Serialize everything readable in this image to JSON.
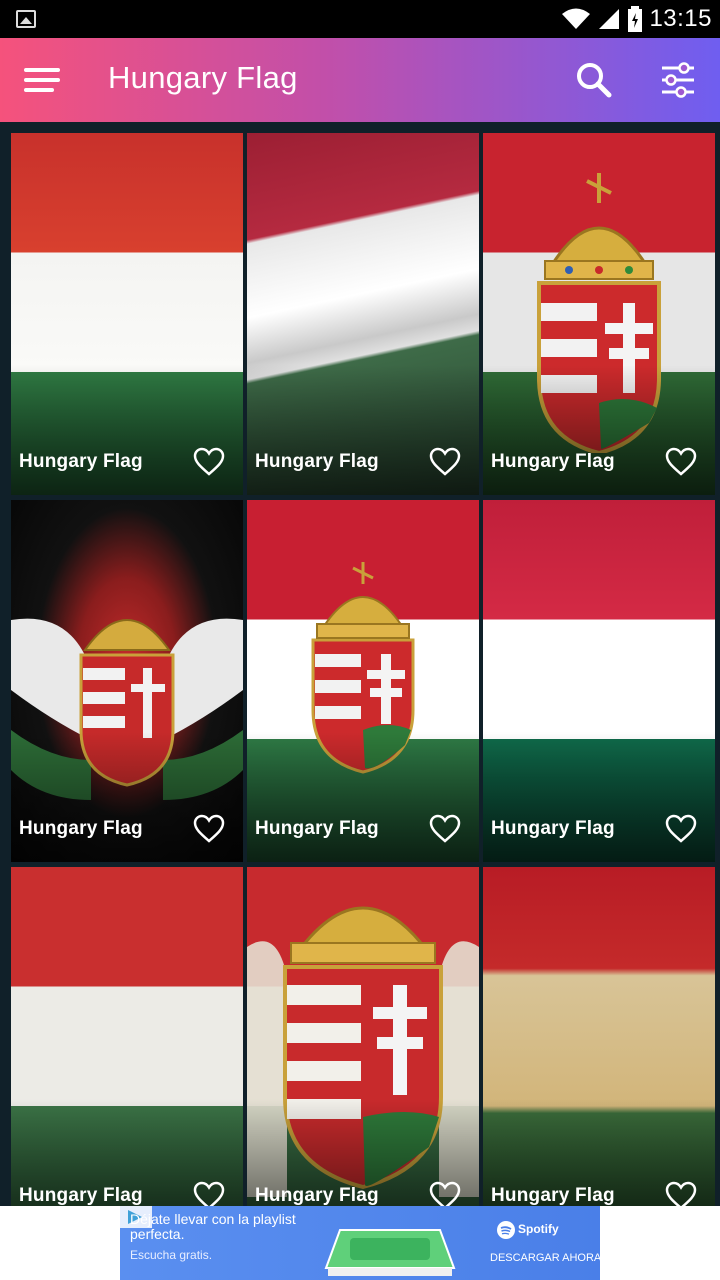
{
  "status_bar": {
    "time": "13:15"
  },
  "app_bar": {
    "title": "Hungary Flag"
  },
  "cards": [
    {
      "label": "Hungary Flag"
    },
    {
      "label": "Hungary Flag"
    },
    {
      "label": "Hungary Flag"
    },
    {
      "label": "Hungary Flag"
    },
    {
      "label": "Hungary Flag"
    },
    {
      "label": "Hungary Flag"
    },
    {
      "label": "Hungary Flag"
    },
    {
      "label": "Hungary Flag"
    },
    {
      "label": "Hungary Flag"
    }
  ],
  "ad": {
    "headline": "Déjate llevar con la playlist perfecta.",
    "sub": "Escucha gratis.",
    "brand": "Spotify",
    "cta": "DESCARGAR AHORA"
  },
  "colors": {
    "red": "#cd2a3e",
    "white": "#ffffff",
    "green": "#436f4d",
    "appbar_start": "#f5527c",
    "appbar_end": "#6f5ef0"
  }
}
